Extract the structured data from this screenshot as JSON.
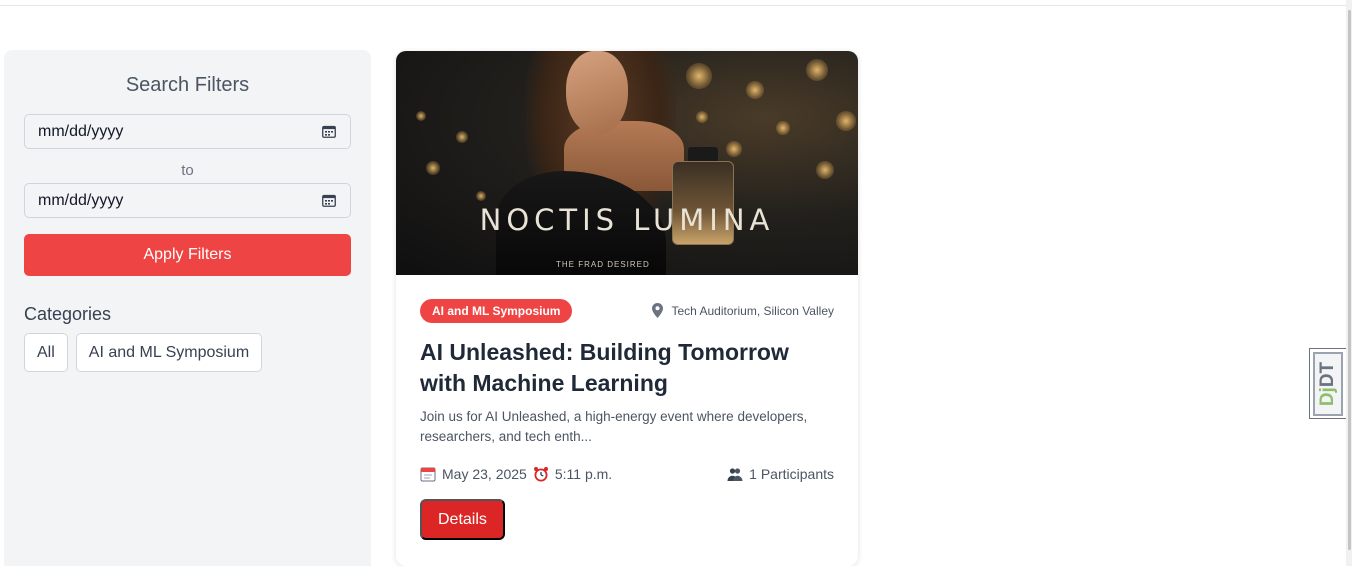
{
  "sidebar": {
    "title": "Search Filters",
    "date_from_placeholder": "mm/dd/yyyy",
    "date_to_placeholder": "mm/dd/yyyy",
    "to_label": "to",
    "apply_label": "Apply Filters",
    "categories_title": "Categories",
    "categories": [
      "All",
      "AI and ML Symposium"
    ]
  },
  "event": {
    "hero": {
      "brand": "NOCTIS LUMINA",
      "tagline": "THE FRAD DESIRED"
    },
    "category": "AI and ML Symposium",
    "location": "Tech Auditorium, Silicon Valley",
    "title": "AI Unleashed: Building Tomorrow with Machine Learning",
    "description": "Join us for AI Unleashed, a high-energy event where developers, researchers, and tech enth...",
    "date": "May 23, 2025",
    "time": "5:11 p.m.",
    "participants": "1 Participants",
    "details_label": "Details"
  },
  "debug_toolbar": {
    "label_dj": "Dj",
    "label_dt": "DT"
  },
  "colors": {
    "accent": "#ef4444",
    "details_button": "#dc2626",
    "sidebar_bg": "#f3f4f6"
  },
  "icons": [
    "calendar-icon",
    "map-pin-icon",
    "date-icon",
    "alarm-clock-icon",
    "participants-icon"
  ]
}
